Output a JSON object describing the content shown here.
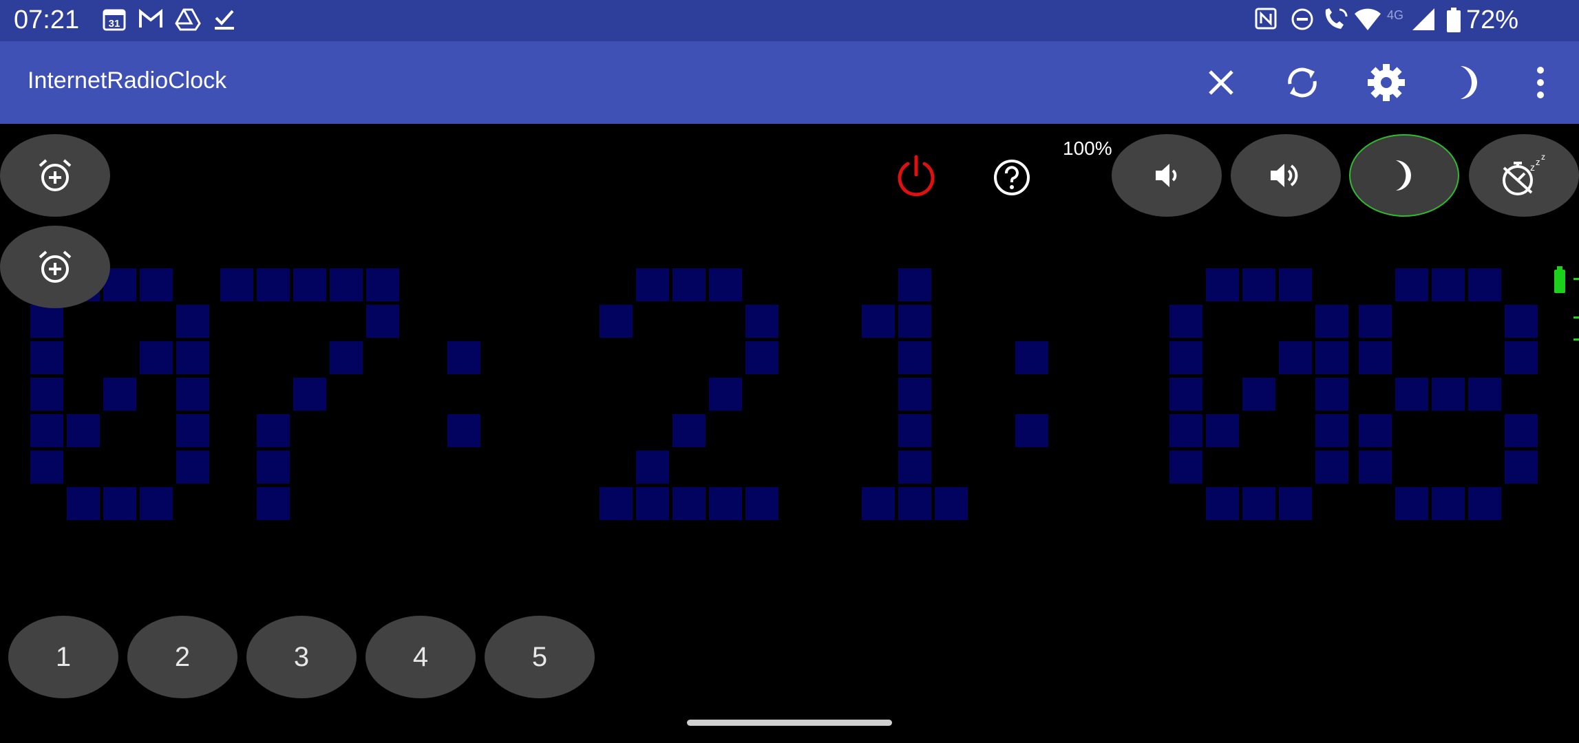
{
  "status_bar": {
    "time": "07:21",
    "battery_percent": "72%",
    "network": "4G",
    "icons": [
      "calendar-icon",
      "gmail-icon",
      "drive-icon",
      "tasks-icon",
      "nfc-icon",
      "dnd-icon",
      "wifi-calling-icon",
      "wifi-icon",
      "signal-icon",
      "battery-icon"
    ]
  },
  "app_bar": {
    "title": "InternetRadioClock",
    "actions": [
      "close-icon",
      "sync-icon",
      "settings-icon",
      "night-mode-icon",
      "more-icon"
    ]
  },
  "controls": {
    "volume_percent": "100%",
    "alarm_buttons": [
      "add-alarm-icon",
      "add-alarm-icon"
    ],
    "power_color": "#e01010",
    "night_selected_border": "#2ebd2e"
  },
  "clock": {
    "time": "07:21:08",
    "dot_color": "#02025f"
  },
  "presets": [
    "1",
    "2",
    "3",
    "4",
    "5"
  ]
}
